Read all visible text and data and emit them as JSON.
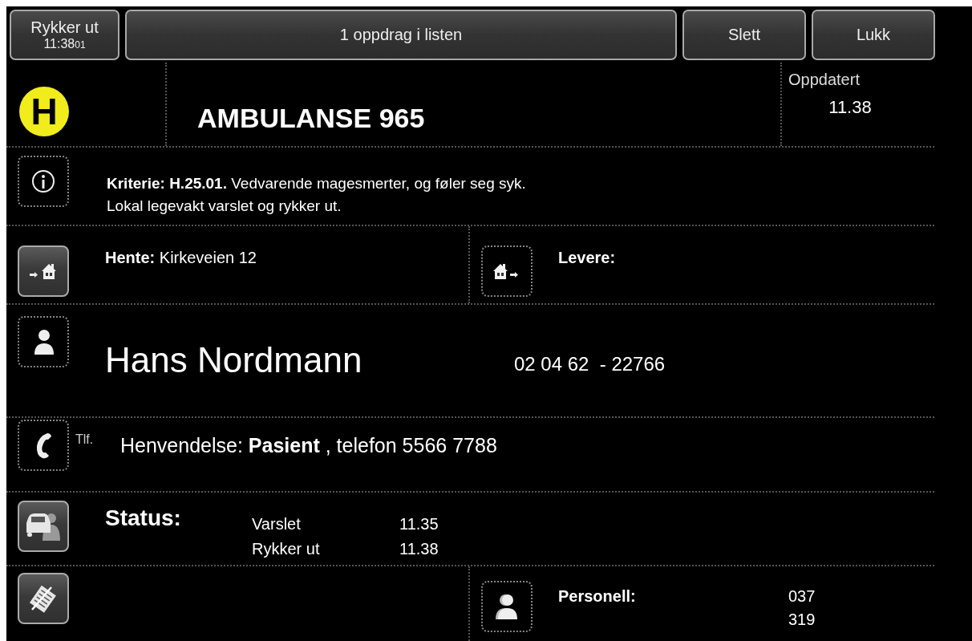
{
  "toolbar": {
    "status_button": {
      "label": "Rykker ut",
      "time": "11:38",
      "seconds": "01"
    },
    "list_button": "1 oppdrag i listen",
    "buttons": [
      "Slett",
      "Lukk"
    ]
  },
  "header": {
    "priority": "H",
    "unit": "AMBULANSE 965",
    "updated_label": "Oppdatert",
    "updated_time": "11.38"
  },
  "info": {
    "raised": false,
    "lines": [
      "**Kriterie: H.25.01.** Vedvarende magesmerter, og føler seg syk.",
      "Lokal legevakt varslet og rykker ut."
    ]
  },
  "pickup": {
    "raised": true,
    "label": "Hente:",
    "value": "Kirkeveien 12"
  },
  "delivery": {
    "raised": false,
    "label": "Levere:"
  },
  "patient": {
    "raised": false,
    "name": "Hans Nordmann",
    "id": "02 04 62  - 22766"
  },
  "caller": {
    "raised": false,
    "prefix": "Tlf.",
    "text": "Henvendelse: **Pasient** , telefon 5566 7788"
  },
  "status": {
    "raised": true,
    "label": "Status:",
    "entries": [
      {
        "name": "Varslet",
        "time": "11.35"
      },
      {
        "name": "Rykker ut",
        "time": "11.38"
      }
    ]
  },
  "notes": {
    "raised": true
  },
  "personnel": {
    "raised": false,
    "label": "Personell:",
    "ids": [
      "037",
      "319"
    ]
  }
}
